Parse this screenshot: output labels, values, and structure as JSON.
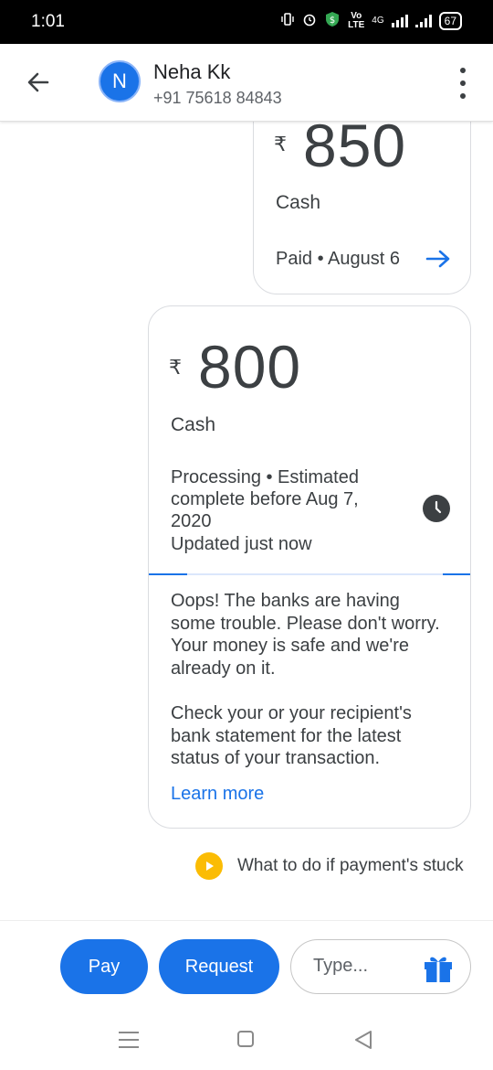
{
  "status_bar": {
    "time": "1:01",
    "volte_label_top": "Vo",
    "volte_label_bottom": "LTE",
    "network": "4G",
    "battery": "67"
  },
  "header": {
    "avatar_initial": "N",
    "contact_name": "Neha Kk",
    "contact_phone": "+91 75618 84843"
  },
  "payments": [
    {
      "currency_symbol": "₹",
      "amount": "850",
      "method": "Cash",
      "status": "Paid • August 6"
    },
    {
      "currency_symbol": "₹",
      "amount": "800",
      "method": "Cash",
      "status_lines": [
        "Processing • Estimated",
        "complete before Aug 7,",
        "2020",
        "Updated just now"
      ],
      "notice_1": "Oops! The banks are having some trouble. Please don't worry. Your money is safe and we're already on it.",
      "notice_2": "Check your or your recipient's bank statement for the latest status of your transaction.",
      "learn_more": "Learn more"
    }
  ],
  "help_link": "What to do if payment's stuck",
  "bottom_bar": {
    "pay_label": "Pay",
    "request_label": "Request",
    "input_placeholder": "Type..."
  },
  "colors": {
    "accent": "#1a73e8",
    "help_icon": "#fbbc04",
    "text": "#3c4043"
  },
  "icons": [
    "back-arrow-icon",
    "more-vert-icon",
    "arrow-right-icon",
    "clock-icon",
    "play-icon",
    "gift-icon",
    "nav-recents-icon",
    "nav-home-icon",
    "nav-back-icon"
  ]
}
